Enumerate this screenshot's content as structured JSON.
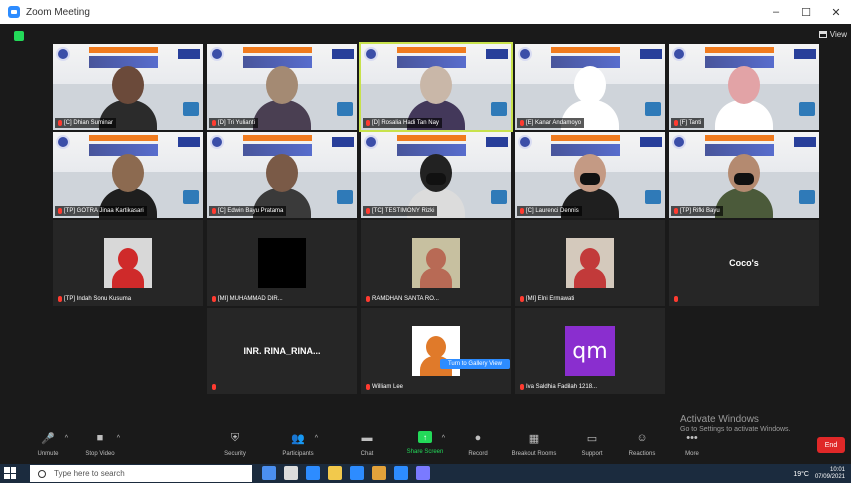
{
  "window": {
    "title": "Zoom Meeting",
    "controls": [
      "–",
      "☐",
      "✕"
    ]
  },
  "header": {
    "view_label": "View"
  },
  "tiles": [
    {
      "row": 1,
      "kind": "video",
      "name": "[C] Dhian Suminar",
      "active": false,
      "mask": false,
      "skin": "#6b4a3a",
      "cloth": "#2b2b2b"
    },
    {
      "row": 1,
      "kind": "video",
      "name": "[D] Tri Yulianti",
      "active": false,
      "mask": false,
      "skin": "#a48a73",
      "cloth": "#4a3f52"
    },
    {
      "row": 1,
      "kind": "video",
      "name": "[D] Rosalia Hadi Tan Nay",
      "active": true,
      "mask": false,
      "skin": "#c9b7a8",
      "cloth": "#43385a"
    },
    {
      "row": 1,
      "kind": "video",
      "name": "[E] Kanar Andamoyo",
      "active": false,
      "mask": false,
      "skin": "#ffffff",
      "cloth": "#ffffff"
    },
    {
      "row": 1,
      "kind": "video",
      "name": "[F] Tanti",
      "active": false,
      "mask": false,
      "skin": "#e2a3a6",
      "cloth": "#ffffff"
    },
    {
      "row": 2,
      "kind": "video",
      "name": "[TP] GOTRA Jinaa Kartikasari",
      "active": false,
      "mask": false,
      "skin": "#8c6a50",
      "cloth": "#1e1e1e"
    },
    {
      "row": 2,
      "kind": "video",
      "name": "[C] Edwin Bayu Pratama",
      "active": false,
      "mask": false,
      "skin": "#7a5a47",
      "cloth": "#3a3a3a"
    },
    {
      "row": 2,
      "kind": "video",
      "name": "[TC] TESTIMONY Rizki",
      "active": false,
      "mask": true,
      "skin": "#222222",
      "cloth": "#dcdcdc"
    },
    {
      "row": 2,
      "kind": "video",
      "name": "[C] Laurenci Dennis",
      "active": false,
      "mask": true,
      "skin": "#c49a84",
      "cloth": "#1f1f1f"
    },
    {
      "row": 2,
      "kind": "video",
      "name": "[TP] Rifki Bayu",
      "active": false,
      "mask": true,
      "skin": "#b48a70",
      "cloth": "#4b5a3a"
    },
    {
      "row": 3,
      "kind": "photo",
      "name": "[TP] Indah Sonu Kusuma",
      "photo": "#d8d8d8",
      "accent": "#cf2a2a"
    },
    {
      "row": 3,
      "kind": "black",
      "name": "[MI] MUHAMMAD DIR..."
    },
    {
      "row": 3,
      "kind": "photo",
      "name": "RAMDHAN SANTA RO...",
      "photo": "#c7c0a0",
      "accent": "#b86a55"
    },
    {
      "row": 3,
      "kind": "photo",
      "name": "[MI] Elni Ermawati",
      "photo": "#d4c9bc",
      "accent": "#c23a3a"
    },
    {
      "row": 3,
      "kind": "text",
      "name": "",
      "label": "Coco's"
    },
    {
      "row": 4,
      "kind": "text",
      "name": "",
      "label": "INR. RINA_RINA..."
    },
    {
      "row": 4,
      "kind": "photo",
      "name": "William Lee",
      "photo": "#ffffff",
      "accent": "#e07a2a"
    },
    {
      "row": 4,
      "kind": "qm",
      "name": "Iva Saldhia Fadilah 1218...",
      "label": "qm"
    }
  ],
  "pill_label": "Turn to Gallery View",
  "toolbar": {
    "left": [
      {
        "name": "unmute-button",
        "icon": "🎤",
        "label": "Unmute",
        "caret": true
      },
      {
        "name": "stop-video-button",
        "icon": "■",
        "label": "Stop Video",
        "caret": true
      }
    ],
    "center": [
      {
        "name": "security-button",
        "icon": "⛨",
        "label": "Security",
        "caret": false
      },
      {
        "name": "participants-button",
        "icon": "👥",
        "label": "Participants",
        "caret": true
      },
      {
        "name": "chat-button",
        "icon": "▬",
        "label": "Chat",
        "caret": false
      },
      {
        "name": "share-screen-button",
        "icon": "↑",
        "label": "Share Screen",
        "caret": true,
        "share": true
      },
      {
        "name": "record-button",
        "icon": "●",
        "label": "Record",
        "caret": false
      },
      {
        "name": "breakout-rooms-button",
        "icon": "▦",
        "label": "Breakout Rooms",
        "caret": false
      },
      {
        "name": "support-button",
        "icon": "▭",
        "label": "Support",
        "caret": false
      },
      {
        "name": "reactions-button",
        "icon": "☺",
        "label": "Reactions",
        "caret": false
      },
      {
        "name": "more-button",
        "icon": "•••",
        "label": "More",
        "caret": false
      }
    ],
    "end_label": "End"
  },
  "activate": {
    "line1": "Activate Windows",
    "line2": "Go to Settings to activate Windows."
  },
  "taskbar": {
    "search_placeholder": "Type here to search",
    "apps": [
      "#4b8ff0",
      "#dcdcdc",
      "#2d8cff",
      "#f2c94c",
      "#2d8cff",
      "#e2a23b",
      "#2d8cff",
      "#7a7aff"
    ],
    "tray_text": "19°C",
    "time": "10:01",
    "date": "07/09/2021"
  },
  "colors": {
    "accent_green": "#23d959",
    "end_red": "#e02828",
    "active_outline": "#c8e24c"
  }
}
